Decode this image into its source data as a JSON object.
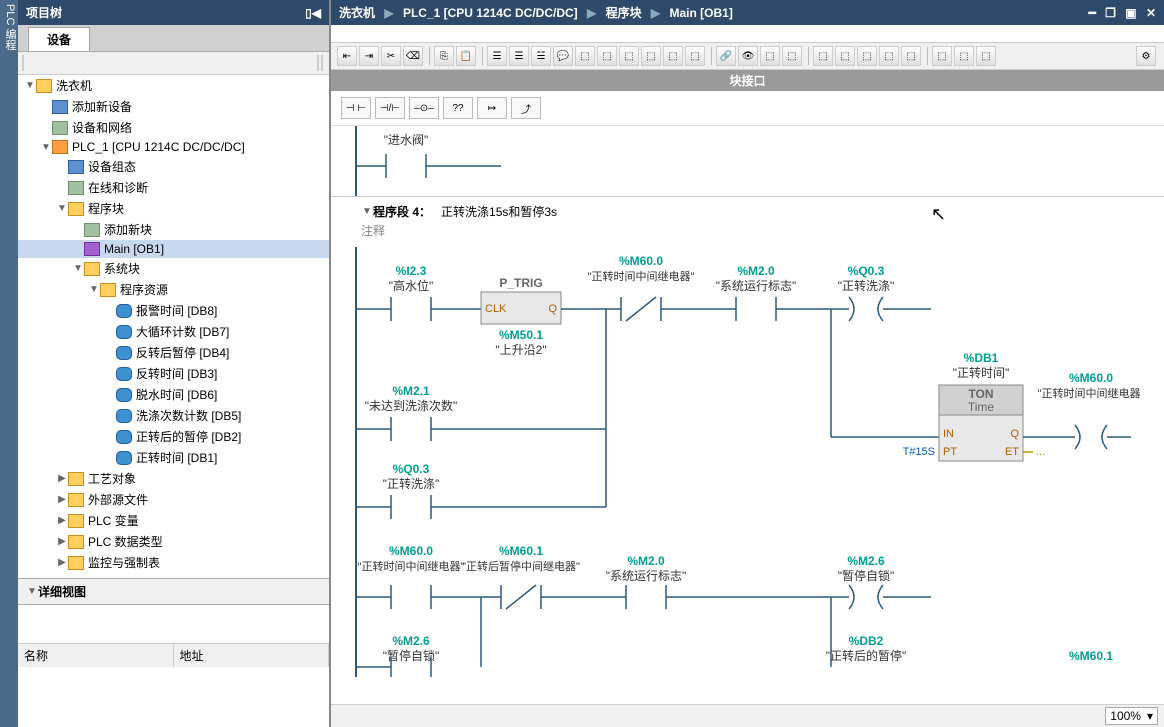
{
  "sideRail": "PLC 编程",
  "projectTree": {
    "title": "项目树",
    "tabLabel": "设备",
    "root": "洗衣机",
    "items": [
      {
        "level": 1,
        "exp": "",
        "iconClass": "ic-device",
        "label": "添加新设备"
      },
      {
        "level": 1,
        "exp": "",
        "iconClass": "ic-generic",
        "label": "设备和网络"
      },
      {
        "level": 1,
        "exp": "▼",
        "iconClass": "ic-plc",
        "label": "PLC_1 [CPU 1214C DC/DC/DC]"
      },
      {
        "level": 2,
        "exp": "",
        "iconClass": "ic-device",
        "label": "设备组态"
      },
      {
        "level": 2,
        "exp": "",
        "iconClass": "ic-generic",
        "label": "在线和诊断"
      },
      {
        "level": 2,
        "exp": "▼",
        "iconClass": "ic-folder",
        "label": "程序块"
      },
      {
        "level": 3,
        "exp": "",
        "iconClass": "ic-generic",
        "label": "添加新块"
      },
      {
        "level": 3,
        "exp": "",
        "iconClass": "ic-block",
        "label": "Main [OB1]",
        "selected": true
      },
      {
        "level": 3,
        "exp": "▼",
        "iconClass": "ic-folder",
        "label": "系统块"
      },
      {
        "level": 4,
        "exp": "▼",
        "iconClass": "ic-folder",
        "label": "程序资源"
      },
      {
        "level": 5,
        "exp": "",
        "iconClass": "ic-db",
        "label": "报警时间 [DB8]"
      },
      {
        "level": 5,
        "exp": "",
        "iconClass": "ic-db",
        "label": "大循环计数 [DB7]"
      },
      {
        "level": 5,
        "exp": "",
        "iconClass": "ic-db",
        "label": "反转后暂停 [DB4]"
      },
      {
        "level": 5,
        "exp": "",
        "iconClass": "ic-db",
        "label": "反转时间 [DB3]"
      },
      {
        "level": 5,
        "exp": "",
        "iconClass": "ic-db",
        "label": "脱水时间 [DB6]"
      },
      {
        "level": 5,
        "exp": "",
        "iconClass": "ic-db",
        "label": "洗涤次数计数 [DB5]"
      },
      {
        "level": 5,
        "exp": "",
        "iconClass": "ic-db",
        "label": "正转后的暂停 [DB2]"
      },
      {
        "level": 5,
        "exp": "",
        "iconClass": "ic-db",
        "label": "正转时间 [DB1]"
      },
      {
        "level": 2,
        "exp": "▶",
        "iconClass": "ic-folder",
        "label": "工艺对象"
      },
      {
        "level": 2,
        "exp": "▶",
        "iconClass": "ic-folder",
        "label": "外部源文件"
      },
      {
        "level": 2,
        "exp": "▶",
        "iconClass": "ic-folder",
        "label": "PLC 变量"
      },
      {
        "level": 2,
        "exp": "▶",
        "iconClass": "ic-folder",
        "label": "PLC 数据类型"
      },
      {
        "level": 2,
        "exp": "▶",
        "iconClass": "ic-folder",
        "label": "监控与强制表"
      }
    ],
    "detailTitle": "详细视图",
    "detailCols": {
      "name": "名称",
      "addr": "地址"
    }
  },
  "breadcrumb": {
    "parts": [
      "洗衣机",
      "PLC_1 [CPU 1214C DC/DC/DC]",
      "程序块",
      "Main [OB1]"
    ]
  },
  "interfaceBar": "块接口",
  "instructions": [
    "⊣ ⊢",
    "⊣/⊢",
    "–⊙–",
    "??",
    "↦",
    "⤴"
  ],
  "network3": {
    "valve": "\"进水阀\""
  },
  "network4": {
    "title": "程序段 4：",
    "subtitle": "正转洗涤15s和暂停3s",
    "comment": "注释",
    "rung1": {
      "c1": {
        "addr": "%I2.3",
        "sym": "\"高水位\""
      },
      "fb": {
        "name": "P_TRIG",
        "clk": "CLK",
        "q": "Q",
        "maddr": "%M50.1",
        "msym": "\"上升沿2\""
      },
      "c2": {
        "addr": "%M60.0",
        "sym": "\"正转时间中间继电器\""
      },
      "c3": {
        "addr": "%M2.0",
        "sym": "\"系统运行标志\""
      },
      "coil": {
        "addr": "%Q0.3",
        "sym": "\"正转洗涤\""
      },
      "branch1": {
        "addr": "%M2.1",
        "sym": "\"未达到洗涤次数\""
      },
      "branch2": {
        "addr": "%Q0.3",
        "sym": "\"正转洗涤\""
      },
      "ton": {
        "db": "%DB1",
        "dbname": "\"正转时间\"",
        "type": "TON",
        "sub": "Time",
        "in": "IN",
        "q": "Q",
        "pt": "PT",
        "et": "ET",
        "ptval": "T#15S",
        "etval": "..."
      },
      "outcoil": {
        "addr": "%M60.0",
        "sym": "\"正转时间中间继电器\""
      }
    },
    "rung2": {
      "c1": {
        "addr": "%M60.0",
        "sym": "\"正转时间中间继电器\""
      },
      "c2": {
        "addr": "%M60.1",
        "sym": "\"正转后暂停中间继电器\""
      },
      "c3": {
        "addr": "%M2.0",
        "sym": "\"系统运行标志\""
      },
      "coil": {
        "addr": "%M2.6",
        "sym": "\"暂停自锁\""
      },
      "branch": {
        "addr": "%M2.6",
        "sym": "\"暂停自锁\""
      },
      "ton": {
        "db": "%DB2",
        "dbname": "\"正转后的暂停\""
      },
      "outcoil": {
        "addr": "%M60.1"
      }
    }
  },
  "zoom": "100%"
}
